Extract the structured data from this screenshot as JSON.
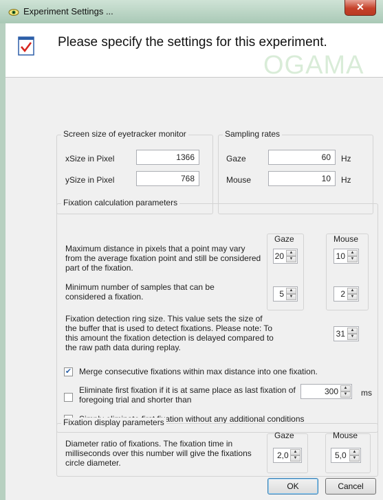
{
  "window": {
    "title": "Experiment Settings ..."
  },
  "header": {
    "title": "Please specify the settings for this experiment.",
    "logo": "OGAMA"
  },
  "screen_size": {
    "title": "Screen size of eyetracker monitor",
    "xsize_label": "xSize in Pixel",
    "xsize_value": "1366",
    "ysize_label": "ySize in Pixel",
    "ysize_value": "768"
  },
  "sampling": {
    "title": "Sampling rates",
    "gaze_label": "Gaze",
    "gaze_value": "60",
    "gaze_unit": "Hz",
    "mouse_label": "Mouse",
    "mouse_value": "10",
    "mouse_unit": "Hz"
  },
  "fixation_calc": {
    "title": "Fixation calculation parameters",
    "col_gaze": "Gaze",
    "col_mouse": "Mouse",
    "max_distance_label": "Maximum distance in pixels that a point may vary from the average fixation point and still be considered part of the fixation.",
    "max_distance_gaze": "20",
    "max_distance_mouse": "10",
    "min_samples_label": "Minimum number of samples that can be considered a fixation.",
    "min_samples_gaze": "5",
    "min_samples_mouse": "2",
    "ring_size_label": "Fixation detection ring size. This value sets the size of the buffer that is used to detect fixations. Please note: To this amount the fixation detection is delayed compared to the raw path data during replay.",
    "ring_size_value": "31",
    "merge_label": "Merge consecutive fixations within max distance into one fixation.",
    "merge_checked": true,
    "eliminate_first_label": "Eliminate first fixation if it is at same place as last fixation of foregoing trial and shorter than",
    "eliminate_first_checked": false,
    "eliminate_first_value": "300",
    "eliminate_first_unit": "ms",
    "simply_eliminate_label": "Simply eliminate first fixation without any additional conditions",
    "simply_eliminate_checked": false
  },
  "fixation_display": {
    "title": "Fixation display parameters",
    "col_gaze": "Gaze",
    "col_mouse": "Mouse",
    "diameter_label": "Diameter ratio of fixations. The fixation time in milliseconds over this number will give the fixations circle diameter.",
    "diameter_gaze": "2,0",
    "diameter_mouse": "5,0"
  },
  "buttons": {
    "ok": "OK",
    "cancel": "Cancel"
  },
  "icons": {
    "app": "eye-icon",
    "header": "checklist-icon",
    "close": "close-icon"
  },
  "colors": {
    "accent": "#3c7fb1",
    "close": "#c5412a"
  }
}
